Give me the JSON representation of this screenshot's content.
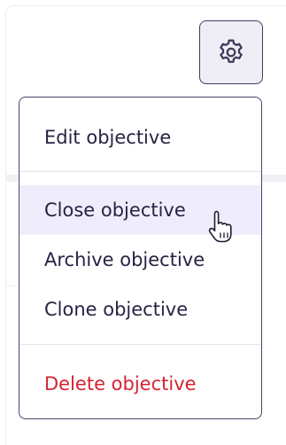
{
  "settings": {
    "icon": "gear-icon"
  },
  "menu": {
    "items": [
      {
        "label": "Edit objective",
        "state": "normal"
      },
      {
        "label": "Close objective",
        "state": "hover"
      },
      {
        "label": "Archive objective",
        "state": "normal"
      },
      {
        "label": "Clone objective",
        "state": "normal"
      },
      {
        "label": "Delete objective",
        "state": "danger"
      }
    ]
  },
  "cursor": {
    "icon": "hand-pointer-cursor"
  },
  "colors": {
    "text": "#262344",
    "danger": "#d42332",
    "hover_bg": "#efedfb",
    "border": "#4a4668"
  }
}
